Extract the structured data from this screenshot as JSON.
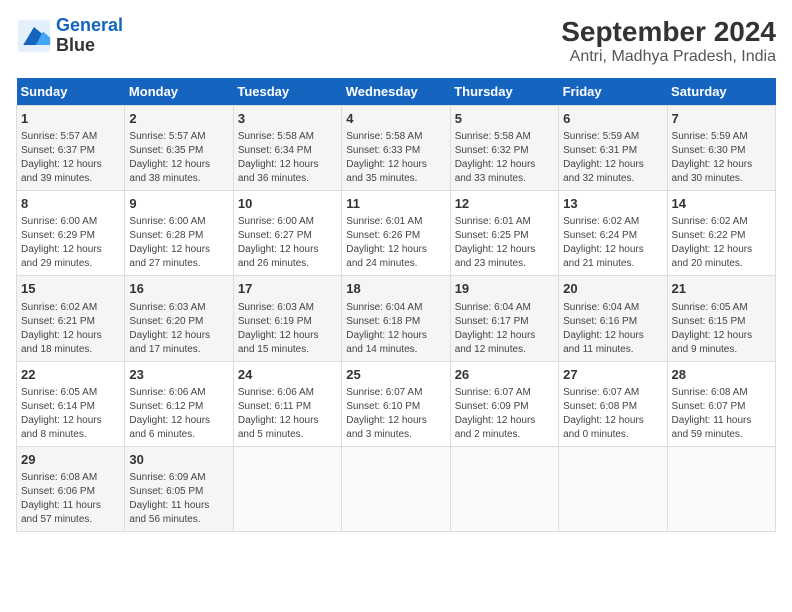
{
  "header": {
    "logo_line1": "General",
    "logo_line2": "Blue",
    "title": "September 2024",
    "subtitle": "Antri, Madhya Pradesh, India"
  },
  "days_of_week": [
    "Sunday",
    "Monday",
    "Tuesday",
    "Wednesday",
    "Thursday",
    "Friday",
    "Saturday"
  ],
  "weeks": [
    [
      {
        "day": 1,
        "info": "Sunrise: 5:57 AM\nSunset: 6:37 PM\nDaylight: 12 hours\nand 39 minutes."
      },
      {
        "day": 2,
        "info": "Sunrise: 5:57 AM\nSunset: 6:35 PM\nDaylight: 12 hours\nand 38 minutes."
      },
      {
        "day": 3,
        "info": "Sunrise: 5:58 AM\nSunset: 6:34 PM\nDaylight: 12 hours\nand 36 minutes."
      },
      {
        "day": 4,
        "info": "Sunrise: 5:58 AM\nSunset: 6:33 PM\nDaylight: 12 hours\nand 35 minutes."
      },
      {
        "day": 5,
        "info": "Sunrise: 5:58 AM\nSunset: 6:32 PM\nDaylight: 12 hours\nand 33 minutes."
      },
      {
        "day": 6,
        "info": "Sunrise: 5:59 AM\nSunset: 6:31 PM\nDaylight: 12 hours\nand 32 minutes."
      },
      {
        "day": 7,
        "info": "Sunrise: 5:59 AM\nSunset: 6:30 PM\nDaylight: 12 hours\nand 30 minutes."
      }
    ],
    [
      {
        "day": 8,
        "info": "Sunrise: 6:00 AM\nSunset: 6:29 PM\nDaylight: 12 hours\nand 29 minutes."
      },
      {
        "day": 9,
        "info": "Sunrise: 6:00 AM\nSunset: 6:28 PM\nDaylight: 12 hours\nand 27 minutes."
      },
      {
        "day": 10,
        "info": "Sunrise: 6:00 AM\nSunset: 6:27 PM\nDaylight: 12 hours\nand 26 minutes."
      },
      {
        "day": 11,
        "info": "Sunrise: 6:01 AM\nSunset: 6:26 PM\nDaylight: 12 hours\nand 24 minutes."
      },
      {
        "day": 12,
        "info": "Sunrise: 6:01 AM\nSunset: 6:25 PM\nDaylight: 12 hours\nand 23 minutes."
      },
      {
        "day": 13,
        "info": "Sunrise: 6:02 AM\nSunset: 6:24 PM\nDaylight: 12 hours\nand 21 minutes."
      },
      {
        "day": 14,
        "info": "Sunrise: 6:02 AM\nSunset: 6:22 PM\nDaylight: 12 hours\nand 20 minutes."
      }
    ],
    [
      {
        "day": 15,
        "info": "Sunrise: 6:02 AM\nSunset: 6:21 PM\nDaylight: 12 hours\nand 18 minutes."
      },
      {
        "day": 16,
        "info": "Sunrise: 6:03 AM\nSunset: 6:20 PM\nDaylight: 12 hours\nand 17 minutes."
      },
      {
        "day": 17,
        "info": "Sunrise: 6:03 AM\nSunset: 6:19 PM\nDaylight: 12 hours\nand 15 minutes."
      },
      {
        "day": 18,
        "info": "Sunrise: 6:04 AM\nSunset: 6:18 PM\nDaylight: 12 hours\nand 14 minutes."
      },
      {
        "day": 19,
        "info": "Sunrise: 6:04 AM\nSunset: 6:17 PM\nDaylight: 12 hours\nand 12 minutes."
      },
      {
        "day": 20,
        "info": "Sunrise: 6:04 AM\nSunset: 6:16 PM\nDaylight: 12 hours\nand 11 minutes."
      },
      {
        "day": 21,
        "info": "Sunrise: 6:05 AM\nSunset: 6:15 PM\nDaylight: 12 hours\nand 9 minutes."
      }
    ],
    [
      {
        "day": 22,
        "info": "Sunrise: 6:05 AM\nSunset: 6:14 PM\nDaylight: 12 hours\nand 8 minutes."
      },
      {
        "day": 23,
        "info": "Sunrise: 6:06 AM\nSunset: 6:12 PM\nDaylight: 12 hours\nand 6 minutes."
      },
      {
        "day": 24,
        "info": "Sunrise: 6:06 AM\nSunset: 6:11 PM\nDaylight: 12 hours\nand 5 minutes."
      },
      {
        "day": 25,
        "info": "Sunrise: 6:07 AM\nSunset: 6:10 PM\nDaylight: 12 hours\nand 3 minutes."
      },
      {
        "day": 26,
        "info": "Sunrise: 6:07 AM\nSunset: 6:09 PM\nDaylight: 12 hours\nand 2 minutes."
      },
      {
        "day": 27,
        "info": "Sunrise: 6:07 AM\nSunset: 6:08 PM\nDaylight: 12 hours\nand 0 minutes."
      },
      {
        "day": 28,
        "info": "Sunrise: 6:08 AM\nSunset: 6:07 PM\nDaylight: 11 hours\nand 59 minutes."
      }
    ],
    [
      {
        "day": 29,
        "info": "Sunrise: 6:08 AM\nSunset: 6:06 PM\nDaylight: 11 hours\nand 57 minutes."
      },
      {
        "day": 30,
        "info": "Sunrise: 6:09 AM\nSunset: 6:05 PM\nDaylight: 11 hours\nand 56 minutes."
      },
      null,
      null,
      null,
      null,
      null
    ]
  ]
}
